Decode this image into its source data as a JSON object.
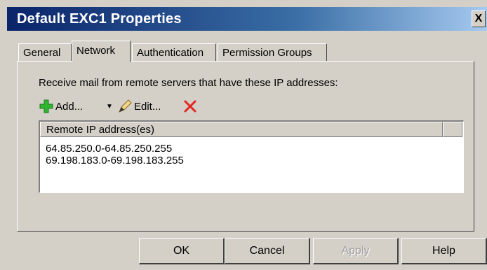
{
  "window": {
    "title": "Default EXC1 Properties",
    "close_glyph": "X"
  },
  "tabs": [
    {
      "label": "General"
    },
    {
      "label": "Network"
    },
    {
      "label": "Authentication"
    },
    {
      "label": "Permission Groups"
    }
  ],
  "network": {
    "intro_text": "Receive mail from remote servers that have these IP addresses:",
    "toolbar": {
      "add_label": "Add...",
      "edit_label": "Edit...",
      "add_icon": "green-plus-icon",
      "edit_icon": "pencil-icon",
      "delete_icon": "red-x-icon",
      "dropdown_glyph": "▼"
    },
    "list": {
      "column_header": "Remote IP address(es)",
      "rows": [
        "64.85.250.0-64.85.250.255",
        "69.198.183.0-69.198.183.255"
      ]
    }
  },
  "buttons": {
    "ok": "OK",
    "cancel": "Cancel",
    "apply": "Apply",
    "help": "Help"
  },
  "colors": {
    "titlebar_start": "#0a246a",
    "dialog_bg": "#d4d0c8",
    "add_icon": "#2fb52f",
    "delete_icon": "#e0261f"
  }
}
